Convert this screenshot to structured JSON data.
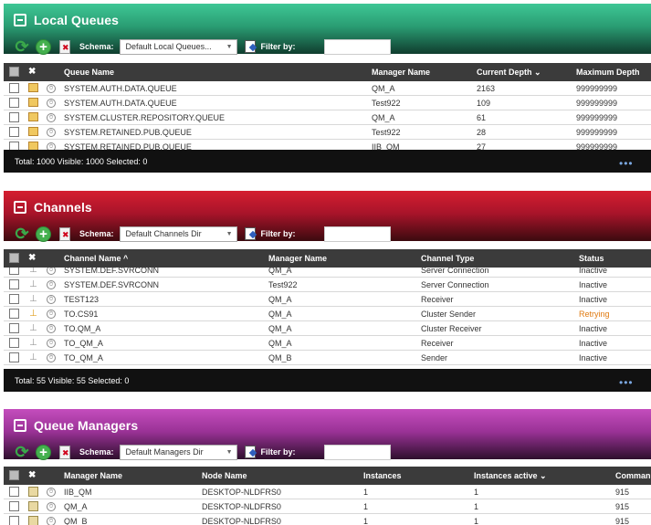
{
  "colors": {
    "local_queues_header": "#2fb586",
    "channels_header": "#c4182a",
    "queue_managers_header": "#b53fb0",
    "retrying": "#e07a10"
  },
  "schema_label": "Schema:",
  "filter_label": "Filter by:",
  "local_queues": {
    "title": "Local Queues",
    "schema_value": "Default Local Queues...",
    "columns": [
      "Queue Name",
      "Manager Name",
      "Current Depth ⌄",
      "Maximum Depth"
    ],
    "rows": [
      [
        "SYSTEM.AUTH.DATA.QUEUE",
        "QM_A",
        "2163",
        "999999999"
      ],
      [
        "SYSTEM.AUTH.DATA.QUEUE",
        "Test922",
        "109",
        "999999999"
      ],
      [
        "SYSTEM.CLUSTER.REPOSITORY.QUEUE",
        "QM_A",
        "61",
        "999999999"
      ],
      [
        "SYSTEM.RETAINED.PUB.QUEUE",
        "Test922",
        "28",
        "999999999"
      ],
      [
        "SYSTEM.RETAINED.PUB.QUEUE",
        "IIB_QM",
        "27",
        "999999999"
      ]
    ],
    "footer": "Total: 1000 Visible: 1000 Selected: 0"
  },
  "channels": {
    "title": "Channels",
    "schema_value": "Default Channels Dir",
    "columns": [
      "Channel Name ^",
      "Manager Name",
      "Channel Type",
      "Status"
    ],
    "rows": [
      [
        "SYSTEM.DEF.SVRCONN",
        "QM_A",
        "Server Connection",
        "Inactive"
      ],
      [
        "SYSTEM.DEF.SVRCONN",
        "Test922",
        "Server Connection",
        "Inactive"
      ],
      [
        "TEST123",
        "QM_A",
        "Receiver",
        "Inactive"
      ],
      [
        "TO.CS91",
        "QM_A",
        "Cluster Sender",
        "Retrying"
      ],
      [
        "TO.QM_A",
        "QM_A",
        "Cluster Receiver",
        "Inactive"
      ],
      [
        "TO_QM_A",
        "QM_A",
        "Receiver",
        "Inactive"
      ],
      [
        "TO_QM_A",
        "QM_B",
        "Sender",
        "Inactive"
      ]
    ],
    "footer": "Total: 55 Visible: 55 Selected: 0"
  },
  "queue_managers": {
    "title": "Queue Managers",
    "schema_value": "Default Managers Dir",
    "columns": [
      "Manager Name",
      "Node Name",
      "Instances",
      "Instances active ⌄",
      "Comman"
    ],
    "rows": [
      [
        "IIB_QM",
        "DESKTOP-NLDFRS0",
        "1",
        "1",
        "915"
      ],
      [
        "QM_A",
        "DESKTOP-NLDFRS0",
        "1",
        "1",
        "915"
      ],
      [
        "QM_B",
        "DESKTOP-NLDFRS0",
        "1",
        "1",
        "915"
      ]
    ]
  },
  "footer_more": "•••"
}
